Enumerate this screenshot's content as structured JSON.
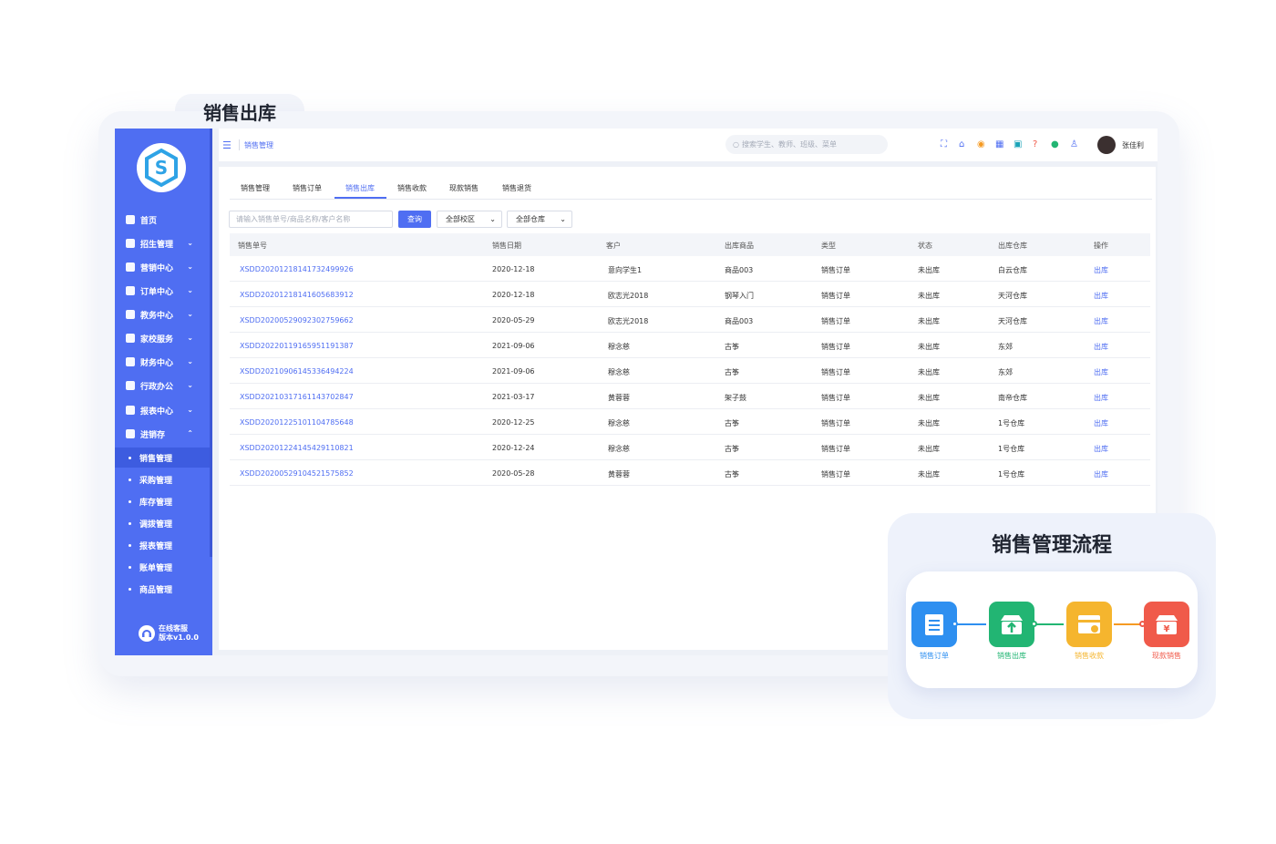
{
  "page_title": "销售出库",
  "sidebar": {
    "menu": [
      {
        "label": "首页",
        "icon": "home-icon",
        "chevron": ""
      },
      {
        "label": "招生管理",
        "icon": "users-icon",
        "chevron": "⌄"
      },
      {
        "label": "营销中心",
        "icon": "marketing-icon",
        "chevron": "⌄"
      },
      {
        "label": "订单中心",
        "icon": "order-icon",
        "chevron": "⌄"
      },
      {
        "label": "教务中心",
        "icon": "calendar-icon",
        "chevron": "⌄"
      },
      {
        "label": "家校服务",
        "icon": "service-icon",
        "chevron": "⌄"
      },
      {
        "label": "财务中心",
        "icon": "finance-icon",
        "chevron": "⌄"
      },
      {
        "label": "行政办公",
        "icon": "office-icon",
        "chevron": "⌄"
      },
      {
        "label": "报表中心",
        "icon": "report-icon",
        "chevron": "⌄"
      },
      {
        "label": "进销存",
        "icon": "inventory-icon",
        "chevron": "⌃"
      }
    ],
    "submenu": [
      "销售管理",
      "采购管理",
      "库存管理",
      "调拨管理",
      "报表管理",
      "账单管理",
      "商品管理"
    ],
    "support_label": "在线客服",
    "version": "版本v1.0.0"
  },
  "topbar": {
    "breadcrumb": "销售管理",
    "search_placeholder": "搜索学生、教师、班级、菜单",
    "user_name": "张佳利"
  },
  "tabs": [
    "销售管理",
    "销售订单",
    "销售出库",
    "销售收款",
    "现款销售",
    "销售退货"
  ],
  "filters": {
    "search_placeholder": "请输入销售单号/商品名称/客户名称",
    "query_label": "查询",
    "campus": "全部校区",
    "warehouse": "全部仓库"
  },
  "table": {
    "headers": [
      "销售单号",
      "销售日期",
      "客户",
      "出库商品",
      "类型",
      "状态",
      "出库仓库",
      "操作"
    ],
    "rows": [
      [
        "XSDD20201218141732499926",
        "2020-12-18",
        "意向学生1",
        "商品003",
        "销售订单",
        "未出库",
        "白云仓库",
        "出库"
      ],
      [
        "XSDD20201218141605683912",
        "2020-12-18",
        "欧志光2018",
        "钢琴入门",
        "销售订单",
        "未出库",
        "天河仓库",
        "出库"
      ],
      [
        "XSDD20200529092302759662",
        "2020-05-29",
        "欧志光2018",
        "商品003",
        "销售订单",
        "未出库",
        "天河仓库",
        "出库"
      ],
      [
        "XSDD20220119165951191387",
        "2021-09-06",
        "穆念慈",
        "古筝",
        "销售订单",
        "未出库",
        "东郊",
        "出库"
      ],
      [
        "XSDD20210906145336494224",
        "2021-09-06",
        "穆念慈",
        "古筝",
        "销售订单",
        "未出库",
        "东郊",
        "出库"
      ],
      [
        "XSDD20210317161143702847",
        "2021-03-17",
        "黄蓉蓉",
        "架子鼓",
        "销售订单",
        "未出库",
        "南帝仓库",
        "出库"
      ],
      [
        "XSDD20201225101104785648",
        "2020-12-25",
        "穆念慈",
        "古筝",
        "销售订单",
        "未出库",
        "1号仓库",
        "出库"
      ],
      [
        "XSDD20201224145429110821",
        "2020-12-24",
        "穆念慈",
        "古筝",
        "销售订单",
        "未出库",
        "1号仓库",
        "出库"
      ],
      [
        "XSDD20200529104521575852",
        "2020-05-28",
        "黄蓉蓉",
        "古筝",
        "销售订单",
        "未出库",
        "1号仓库",
        "出库"
      ]
    ]
  },
  "flow": {
    "title": "销售管理流程",
    "steps": [
      {
        "label": "销售订单",
        "color": "#2e8ff0",
        "icon": "document-icon"
      },
      {
        "label": "销售出库",
        "color": "#22b573",
        "icon": "box-out-icon"
      },
      {
        "label": "销售收款",
        "color": "#f5b52e",
        "icon": "wallet-icon"
      },
      {
        "label": "现款销售",
        "color": "#f05a4a",
        "icon": "cash-box-icon",
        "glyph": "¥"
      }
    ]
  },
  "colors": {
    "accent": "#4f6ef2",
    "sidebar": "#4f6ef2"
  }
}
